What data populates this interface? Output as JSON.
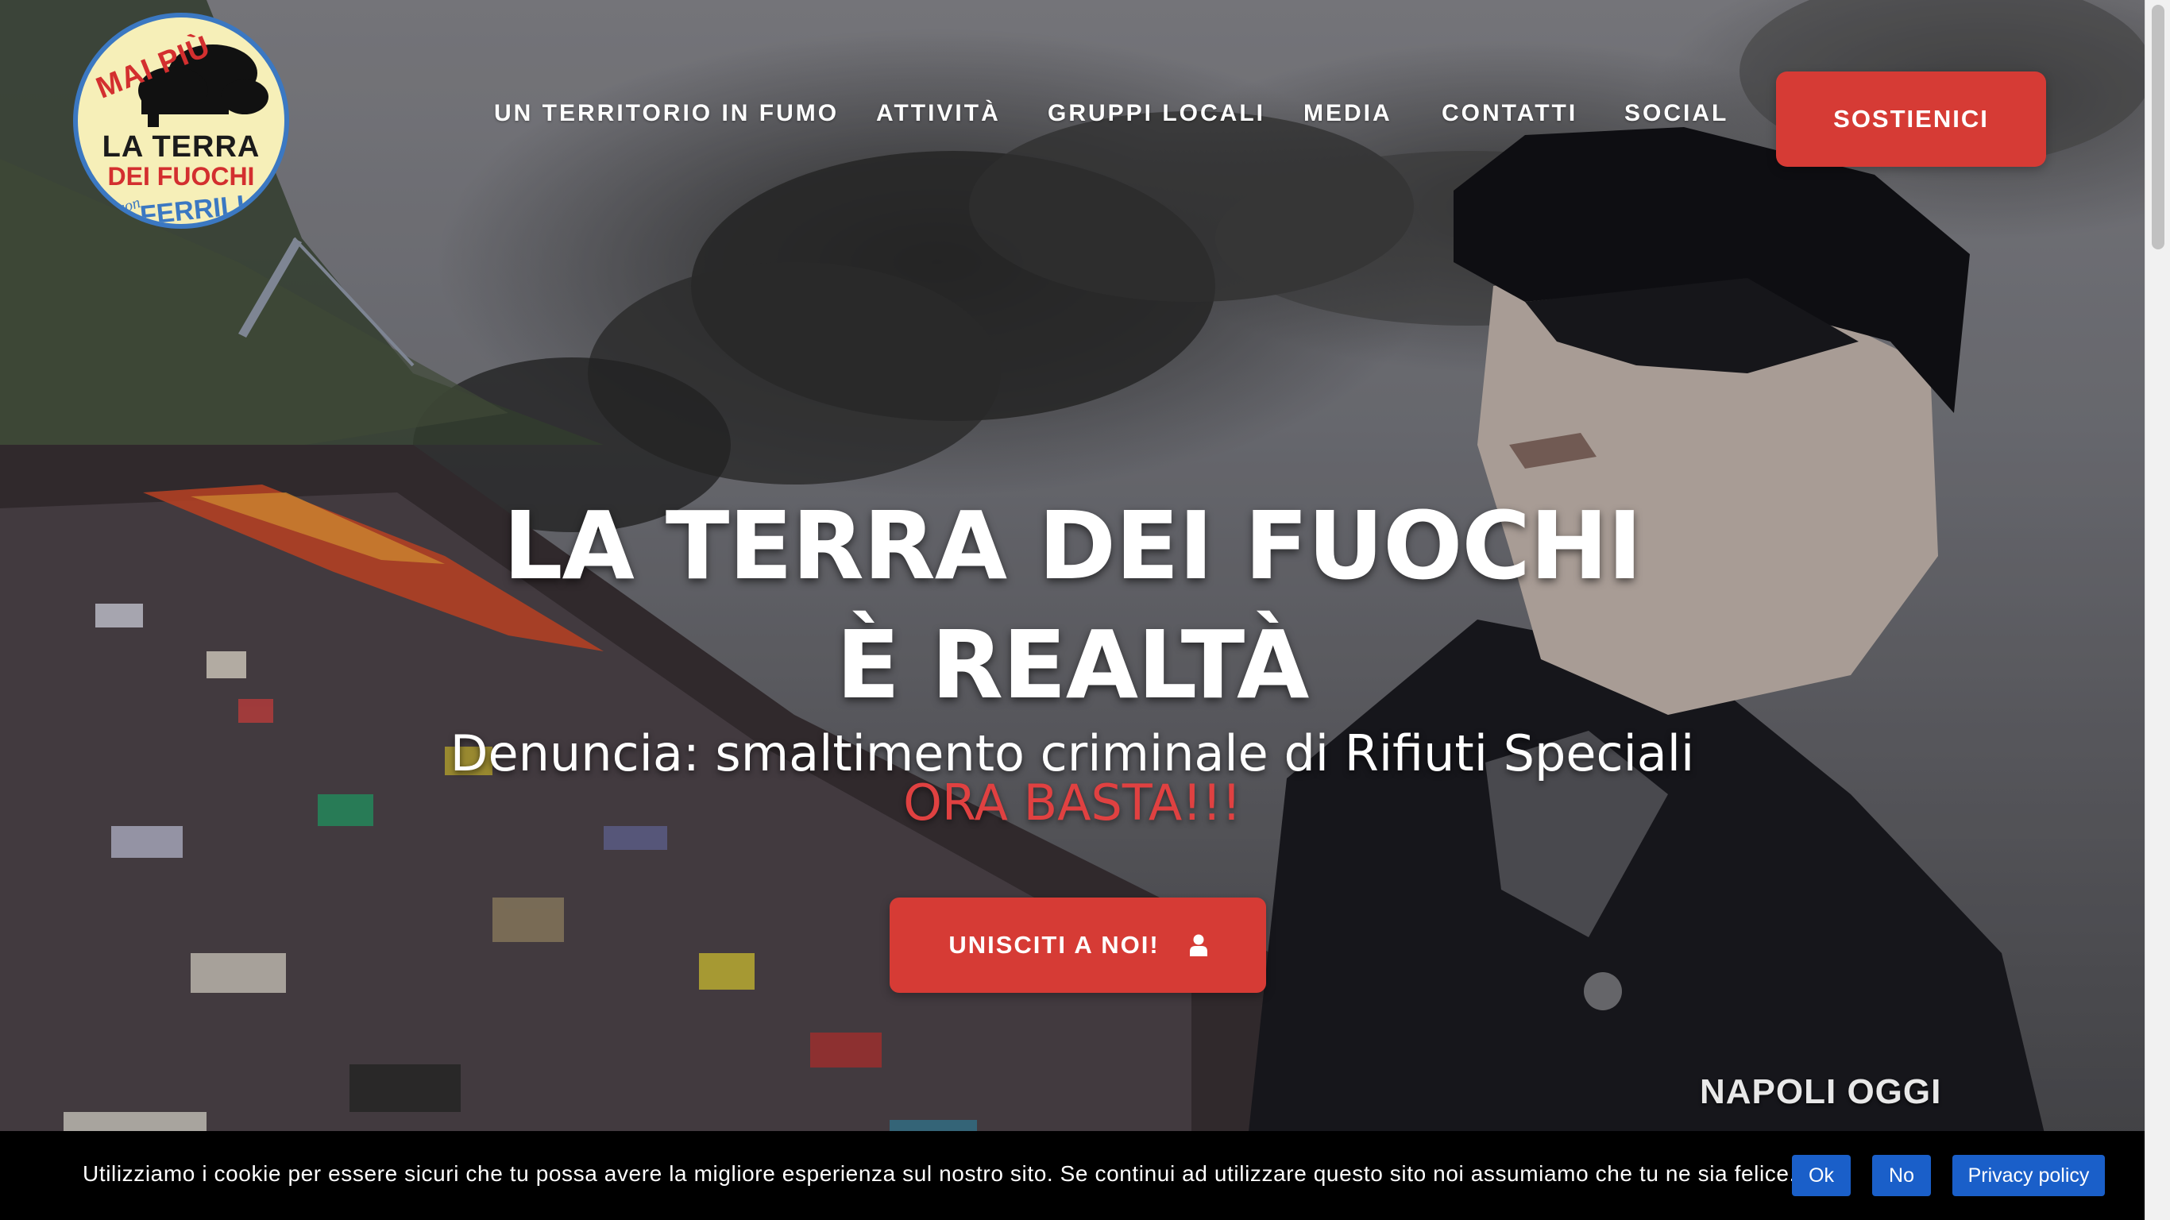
{
  "logo": {
    "top_text": "MAI PIÙ",
    "line1": "LA TERRA",
    "line2": "DEI FUOCHI",
    "con": "con",
    "name": "FERRILLO"
  },
  "nav": {
    "items": [
      {
        "label": "UN TERRITORIO IN FUMO"
      },
      {
        "label": "ATTIVITÀ"
      },
      {
        "label": "GRUPPI LOCALI"
      },
      {
        "label": "MEDIA"
      },
      {
        "label": "CONTATTI"
      },
      {
        "label": "SOCIAL"
      }
    ],
    "cta_label": "SOSTIENICI"
  },
  "hero": {
    "title_line1": "LA TERRA DEI FUOCHI",
    "title_line2": "È REALTÀ",
    "subtitle": "Denuncia: smaltimento criminale di Rifiuti Speciali",
    "subtitle_highlight": "ORA BASTA!!!",
    "join_label": "UNISCITI A NOI!",
    "join_icon": "user-icon",
    "watermark": "NAPOLI OGGI"
  },
  "cookie": {
    "message": "Utilizziamo i cookie per essere sicuri che tu possa avere la migliore esperienza sul nostro sito. Se continui ad utilizzare questo sito noi assumiamo che tu ne sia felice.",
    "ok_label": "Ok",
    "no_label": "No",
    "privacy_label": "Privacy policy"
  },
  "colors": {
    "accent_red": "#d63b35",
    "highlight_red": "#e04141",
    "cookie_button_blue": "#1a5fc9",
    "logo_blue": "#3b78c2",
    "logo_cream": "#f6efb8"
  }
}
